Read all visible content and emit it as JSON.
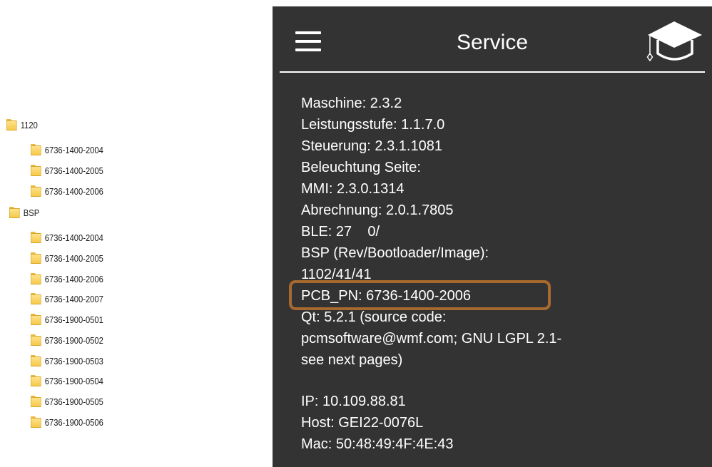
{
  "folder_tree": {
    "groups": [
      {
        "name": "1120",
        "children": [
          "6736-1400-2004",
          "6736-1400-2005",
          "6736-1400-2006"
        ]
      },
      {
        "name": "BSP",
        "children": [
          "6736-1400-2004",
          "6736-1400-2005",
          "6736-1400-2006",
          "6736-1400-2007",
          "6736-1900-0501",
          "6736-1900-0502",
          "6736-1900-0503",
          "6736-1900-0504",
          "6736-1900-0505",
          "6736-1900-0506"
        ]
      }
    ]
  },
  "service": {
    "title": "Service",
    "icons": {
      "menu": "hamburger-menu-icon",
      "cap": "graduation-cap-icon"
    },
    "accent_color": "#a8692f",
    "background_color": "#333333",
    "lines": [
      "Maschine: 2.3.2",
      "Leistungsstufe: 1.1.7.0",
      "Steuerung: 2.3.1.1081",
      "Beleuchtung Seite:",
      "MMI: 2.3.0.1314",
      "Abrechnung: 2.0.1.7805",
      "BLE: 27    0/",
      "BSP (Rev/Bootloader/Image):",
      "1102/41/41",
      "PCB_PN: 6736-1400-2006",
      "Qt: 5.2.1 (source code:",
      "pcmsoftware@wmf.com; GNU LGPL 2.1-",
      "see next pages)",
      "",
      "IP: 10.109.88.81",
      "Host: GEI22-0076L",
      "Mac: 50:48:49:4F:4E:43"
    ]
  }
}
